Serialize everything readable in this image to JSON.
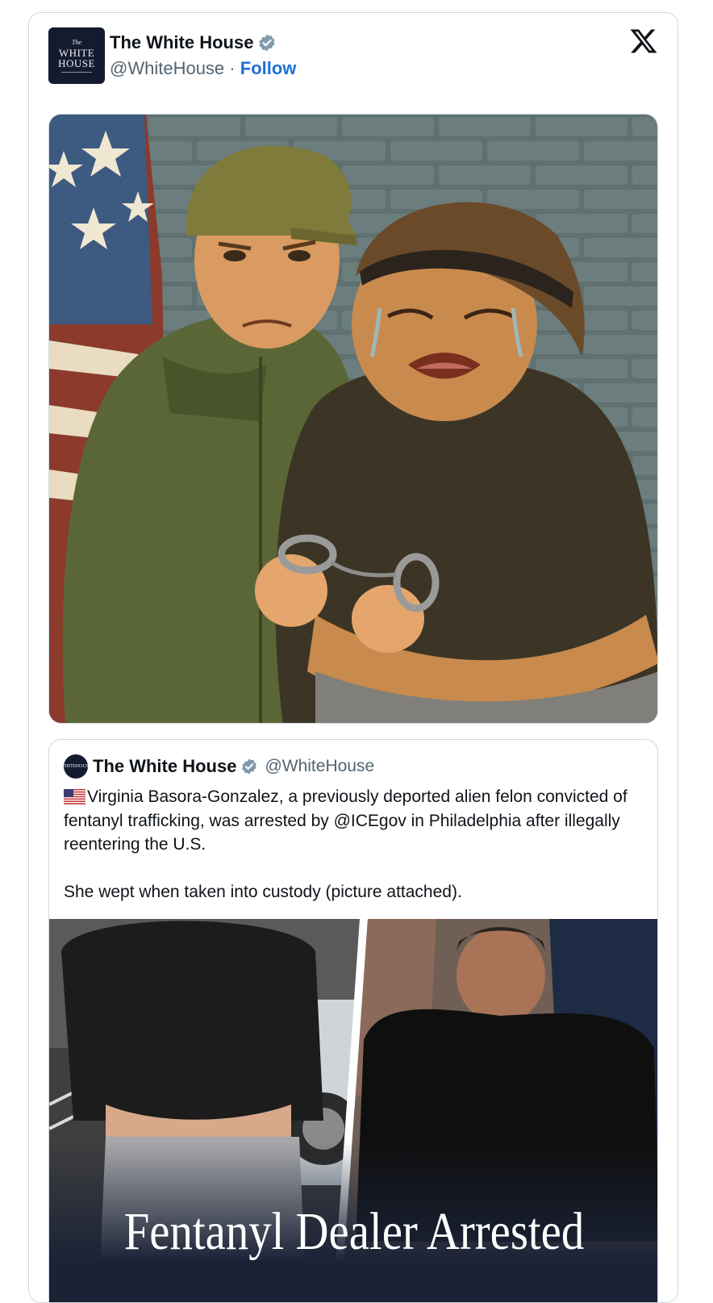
{
  "post": {
    "author_name": "The White House",
    "handle": "@WhiteHouse",
    "separator": "·",
    "follow_label": "Follow",
    "avatar": {
      "line1": "The",
      "line2": "WHITE",
      "line3": "HOUSE"
    },
    "icons": {
      "verified": "verified-badge-icon",
      "platform": "x-logo-icon"
    },
    "colors": {
      "verified": "#829aab",
      "follow": "#1d70d6",
      "avatar_bg": "#151b2e"
    }
  },
  "quoted": {
    "author_name": "The White House",
    "handle": "@WhiteHouse",
    "avatar": {
      "line1": "WHITE",
      "line2": "HOUSE"
    },
    "text": "Virginia Basora-Gonzalez, a previously deported alien felon convicted of fentanyl trafficking, was arrested by @ICEgov in Philadelphia after illegally reentering the U.S.\n\nShe wept when taken into custody (picture attached).",
    "flag_icon": "us-flag-icon",
    "image_caption": "Fentanyl Dealer Arrested"
  }
}
